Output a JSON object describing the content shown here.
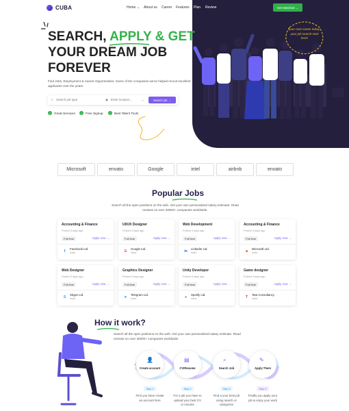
{
  "brand": {
    "name": "CUBA"
  },
  "nav": {
    "items": [
      "Home ⌄",
      "About us",
      "Career",
      "Features",
      "Plan",
      "Review"
    ]
  },
  "header": {
    "cta_label": "Get Matched →"
  },
  "hero": {
    "line1_a": "SEARCH, ",
    "line1_b": "APPLY & GET",
    "line2": "YOUR DREAM JOB",
    "line3": "FOREVER",
    "subtitle": "Find Jobs, Employment & Career Opportunities. Some of the companies we've helped recruit excellent applicants over the years.",
    "search_placeholder": "Search job type",
    "location_placeholder": "Enter location...",
    "search_button": "Search job →",
    "features": [
      "Great Services",
      "Free Signup",
      "Best Talent Tools"
    ],
    "bubble_text": "your next career today, your job search start here!"
  },
  "brands": [
    "Microsoft",
    "envato",
    "Google",
    "intel",
    "airbnb",
    "envato"
  ],
  "popular": {
    "title": "Popular Jobs",
    "subtitle": "Search all the open positions on the web. Get your own personalized salary estimate. Read reviews on over 30000+ companies worldwide.",
    "full_time": "Full time",
    "apply": "Apply now →",
    "jobs": [
      {
        "title": "Accounting & Finance",
        "posted": "Posted 3 days ago",
        "company": "Facebook Ltd.",
        "location": "India",
        "logo": "f",
        "color": "#1877f2"
      },
      {
        "title": "UI/UX Designer",
        "posted": "Posted 3 days ago",
        "company": "Google Ltd.",
        "location": "India",
        "logo": "G",
        "color": "#ea4335"
      },
      {
        "title": "Web Development",
        "posted": "Posted 3 days ago",
        "company": "LinkedIn Ltd.",
        "location": "India",
        "logo": "in",
        "color": "#0a66c2"
      },
      {
        "title": "Accounting & Finance",
        "posted": "Posted 3 days ago",
        "company": "Microsoft Ltd.",
        "location": "India",
        "logo": "■",
        "color": "#f25022"
      },
      {
        "title": "Web Designer",
        "posted": "Posted 3 days ago",
        "company": "Skype Ltd.",
        "location": "India",
        "logo": "S",
        "color": "#00aff0"
      },
      {
        "title": "Graphics Designer",
        "posted": "Posted 3 days ago",
        "company": "Telegram Ltd.",
        "location": "India",
        "logo": "➤",
        "color": "#2aa3dd"
      },
      {
        "title": "Unity Developer",
        "posted": "Posted 3 days ago",
        "company": "Spotify Ltd.",
        "location": "India",
        "logo": "●",
        "color": "#1db954"
      },
      {
        "title": "Game designer",
        "posted": "Posted 3 days ago",
        "company": "Tata Consultancy",
        "location": "India",
        "logo": "T",
        "color": "#d5302f"
      }
    ]
  },
  "how": {
    "title": "How it work?",
    "subtitle": "Search all the open positions on the web. Get your own personalized salary estimate. Read reviews on over 30000+ companies worldwide.",
    "steps": [
      {
        "label": "Create account",
        "badge": "Step 1",
        "desc": "First you have create an account here",
        "icon": "👤"
      },
      {
        "label": "CV/Resume",
        "badge": "Step 2",
        "desc": "For a job you have to upload your best CV or resume",
        "icon": "▤"
      },
      {
        "label": "Search Job",
        "badge": "Step 3",
        "desc": "Find a your best job using search or categories",
        "icon": "⌕"
      },
      {
        "label": "Apply Them",
        "badge": "Step 4",
        "desc": "Finally you apply your job & enjoy your work",
        "icon": "✎"
      }
    ]
  },
  "colors": {
    "accent": "#7d5cf0",
    "green": "#34b24a",
    "dark": "#241f3c"
  }
}
